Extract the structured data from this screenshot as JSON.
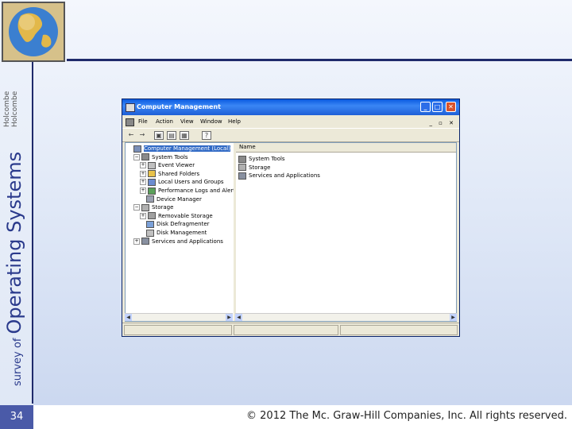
{
  "slide": {
    "series_small": "survey of",
    "series_big": "Operating Systems",
    "author_line1": "Holcombe",
    "author_line2": "Holcombe",
    "page_number": "34",
    "copyright": "© 2012 The Mc. Graw-Hill Companies, Inc. All rights reserved."
  },
  "window": {
    "title": "Computer Management",
    "menu": [
      "File",
      "Action",
      "View",
      "Window",
      "Help"
    ],
    "mdi_controls": "_ ▫ ✕",
    "toolbar_icons": [
      "back-arrow-icon",
      "forward-arrow-icon",
      "up-folder-icon",
      "show-tree-icon",
      "properties-icon",
      "help-icon"
    ],
    "tree": [
      {
        "label": "Computer Management (Local)",
        "indent": 0,
        "expander": "",
        "icon": "computer-icon",
        "selected": true
      },
      {
        "label": "System Tools",
        "indent": 1,
        "expander": "−",
        "icon": "tools-icon"
      },
      {
        "label": "Event Viewer",
        "indent": 2,
        "expander": "+",
        "icon": "event-viewer-icon"
      },
      {
        "label": "Shared Folders",
        "indent": 2,
        "expander": "+",
        "icon": "shared-folder-icon"
      },
      {
        "label": "Local Users and Groups",
        "indent": 2,
        "expander": "+",
        "icon": "users-icon"
      },
      {
        "label": "Performance Logs and Alerts",
        "indent": 2,
        "expander": "+",
        "icon": "performance-icon"
      },
      {
        "label": "Device Manager",
        "indent": 2,
        "expander": "",
        "icon": "device-manager-icon"
      },
      {
        "label": "Storage",
        "indent": 1,
        "expander": "−",
        "icon": "storage-icon"
      },
      {
        "label": "Removable Storage",
        "indent": 2,
        "expander": "+",
        "icon": "removable-storage-icon"
      },
      {
        "label": "Disk Defragmenter",
        "indent": 2,
        "expander": "",
        "icon": "defrag-icon"
      },
      {
        "label": "Disk Management",
        "indent": 2,
        "expander": "",
        "icon": "disk-management-icon"
      },
      {
        "label": "Services and Applications",
        "indent": 1,
        "expander": "+",
        "icon": "services-icon"
      }
    ],
    "list_header": "Name",
    "list_items": [
      {
        "label": "System Tools",
        "icon": "tools-icon"
      },
      {
        "label": "Storage",
        "icon": "storage-icon"
      },
      {
        "label": "Services and Applications",
        "icon": "services-icon"
      }
    ]
  }
}
